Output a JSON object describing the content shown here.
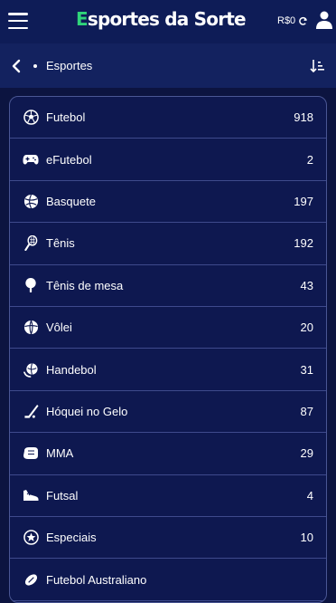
{
  "header": {
    "logo_e": "E",
    "logo_rest": "sportes da Sorte",
    "balance": "R$0"
  },
  "nav": {
    "breadcrumb": "Esportes"
  },
  "sports": [
    {
      "name": "Futebol",
      "count": "918",
      "icon": "soccer-ball-icon"
    },
    {
      "name": "eFutebol",
      "count": "2",
      "icon": "gamepad-icon"
    },
    {
      "name": "Basquete",
      "count": "197",
      "icon": "basketball-icon"
    },
    {
      "name": "Tênis",
      "count": "192",
      "icon": "tennis-racket-icon"
    },
    {
      "name": "Tênis de mesa",
      "count": "43",
      "icon": "table-tennis-icon"
    },
    {
      "name": "Vôlei",
      "count": "20",
      "icon": "volleyball-icon"
    },
    {
      "name": "Handebol",
      "count": "31",
      "icon": "handball-icon"
    },
    {
      "name": "Hóquei no Gelo",
      "count": "87",
      "icon": "hockey-stick-icon"
    },
    {
      "name": "MMA",
      "count": "29",
      "icon": "mma-glove-icon"
    },
    {
      "name": "Futsal",
      "count": "4",
      "icon": "futsal-shoe-icon"
    },
    {
      "name": "Especiais",
      "count": "10",
      "icon": "star-badge-icon"
    },
    {
      "name": "Futebol Australiano",
      "count": "",
      "icon": "australian-football-icon"
    }
  ],
  "colors": {
    "background": "#0c1440",
    "topbar": "#0e1c57",
    "subbar": "#13225f",
    "logo_accent": "#2fd37a",
    "row_border": "#3e4a8c"
  }
}
